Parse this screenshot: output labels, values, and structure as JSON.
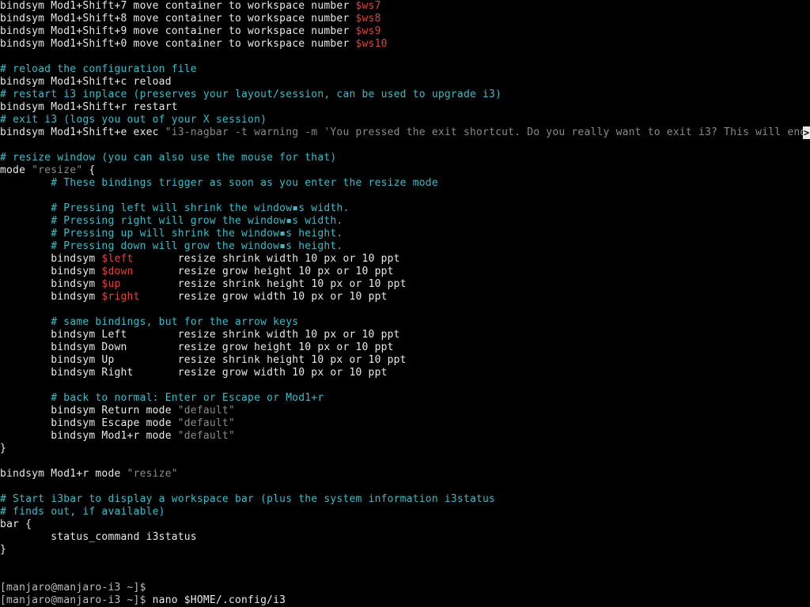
{
  "terminal": {
    "colors": {
      "background": "#000000",
      "default": "#e8e8e8",
      "comment": "#2fbfc8",
      "variable": "#e2403c",
      "string": "#8a8a8a"
    },
    "overflow_marker": ">",
    "lines": [
      [
        {
          "t": "bindsym Mod1+Shift+7 move container to workspace number ",
          "c": "default"
        },
        {
          "t": "$ws7",
          "c": "var"
        }
      ],
      [
        {
          "t": "bindsym Mod1+Shift+8 move container to workspace number ",
          "c": "default"
        },
        {
          "t": "$ws8",
          "c": "var"
        }
      ],
      [
        {
          "t": "bindsym Mod1+Shift+9 move container to workspace number ",
          "c": "default"
        },
        {
          "t": "$ws9",
          "c": "var"
        }
      ],
      [
        {
          "t": "bindsym Mod1+Shift+0 move container to workspace number ",
          "c": "default"
        },
        {
          "t": "$ws10",
          "c": "var"
        }
      ],
      [],
      [
        {
          "t": "# reload the configuration file",
          "c": "comment"
        }
      ],
      [
        {
          "t": "bindsym Mod1+Shift+c reload",
          "c": "default"
        }
      ],
      [
        {
          "t": "# restart i3 inplace (preserves your layout/session, can be used to upgrade i3)",
          "c": "comment"
        }
      ],
      [
        {
          "t": "bindsym Mod1+Shift+r restart",
          "c": "default"
        }
      ],
      [
        {
          "t": "# exit i3 (logs you out of your X session)",
          "c": "comment"
        }
      ],
      [
        {
          "t": "bindsym Mod1+Shift+e exec ",
          "c": "default"
        },
        {
          "t": "\"i3-nagbar -t warning -m 'You pressed the exit shortcut. Do you really want to exit i3? This will end",
          "c": "string"
        }
      ],
      [],
      [
        {
          "t": "# resize window (you can also use the mouse for that)",
          "c": "comment"
        }
      ],
      [
        {
          "t": "mode ",
          "c": "default"
        },
        {
          "t": "\"resize\"",
          "c": "string"
        },
        {
          "t": " {",
          "c": "default"
        }
      ],
      [
        {
          "t": "        # These bindings trigger as soon as you enter the resize mode",
          "c": "comment"
        }
      ],
      [],
      [
        {
          "t": "        # Pressing left will shrink the window▪s width.",
          "c": "comment"
        }
      ],
      [
        {
          "t": "        # Pressing right will grow the window▪s width.",
          "c": "comment"
        }
      ],
      [
        {
          "t": "        # Pressing up will shrink the window▪s height.",
          "c": "comment"
        }
      ],
      [
        {
          "t": "        # Pressing down will grow the window▪s height.",
          "c": "comment"
        }
      ],
      [
        {
          "t": "        bindsym ",
          "c": "default"
        },
        {
          "t": "$left",
          "c": "var"
        },
        {
          "t": "       resize shrink width 10 px or 10 ppt",
          "c": "default"
        }
      ],
      [
        {
          "t": "        bindsym ",
          "c": "default"
        },
        {
          "t": "$down",
          "c": "var"
        },
        {
          "t": "       resize grow height 10 px or 10 ppt",
          "c": "default"
        }
      ],
      [
        {
          "t": "        bindsym ",
          "c": "default"
        },
        {
          "t": "$up",
          "c": "var"
        },
        {
          "t": "         resize shrink height 10 px or 10 ppt",
          "c": "default"
        }
      ],
      [
        {
          "t": "        bindsym ",
          "c": "default"
        },
        {
          "t": "$right",
          "c": "var"
        },
        {
          "t": "      resize grow width 10 px or 10 ppt",
          "c": "default"
        }
      ],
      [],
      [
        {
          "t": "        # same bindings, but for the arrow keys",
          "c": "comment"
        }
      ],
      [
        {
          "t": "        bindsym Left        resize shrink width 10 px or 10 ppt",
          "c": "default"
        }
      ],
      [
        {
          "t": "        bindsym Down        resize grow height 10 px or 10 ppt",
          "c": "default"
        }
      ],
      [
        {
          "t": "        bindsym Up          resize shrink height 10 px or 10 ppt",
          "c": "default"
        }
      ],
      [
        {
          "t": "        bindsym Right       resize grow width 10 px or 10 ppt",
          "c": "default"
        }
      ],
      [],
      [
        {
          "t": "        # back to normal: Enter or Escape or Mod1+r",
          "c": "comment"
        }
      ],
      [
        {
          "t": "        bindsym Return mode ",
          "c": "default"
        },
        {
          "t": "\"default\"",
          "c": "string"
        }
      ],
      [
        {
          "t": "        bindsym Escape mode ",
          "c": "default"
        },
        {
          "t": "\"default\"",
          "c": "string"
        }
      ],
      [
        {
          "t": "        bindsym Mod1+r mode ",
          "c": "default"
        },
        {
          "t": "\"default\"",
          "c": "string"
        }
      ],
      [
        {
          "t": "}",
          "c": "default"
        }
      ],
      [],
      [
        {
          "t": "bindsym Mod1+r mode ",
          "c": "default"
        },
        {
          "t": "\"resize\"",
          "c": "string"
        }
      ],
      [],
      [
        {
          "t": "# Start i3bar to display a workspace bar (plus the system information i3status",
          "c": "comment"
        }
      ],
      [
        {
          "t": "# finds out, if available)",
          "c": "comment"
        }
      ],
      [
        {
          "t": "bar {",
          "c": "default"
        }
      ],
      [
        {
          "t": "        status_command i3status",
          "c": "default"
        }
      ],
      [
        {
          "t": "}",
          "c": "default"
        }
      ],
      [],
      [],
      [
        {
          "t": "[manjaro@manjaro-i3 ~]$",
          "c": "prompt"
        }
      ],
      [
        {
          "t": "[manjaro@manjaro-i3 ~]$ ",
          "c": "prompt"
        },
        {
          "t": "nano $HOME/.config/i3",
          "c": "default"
        }
      ]
    ]
  }
}
